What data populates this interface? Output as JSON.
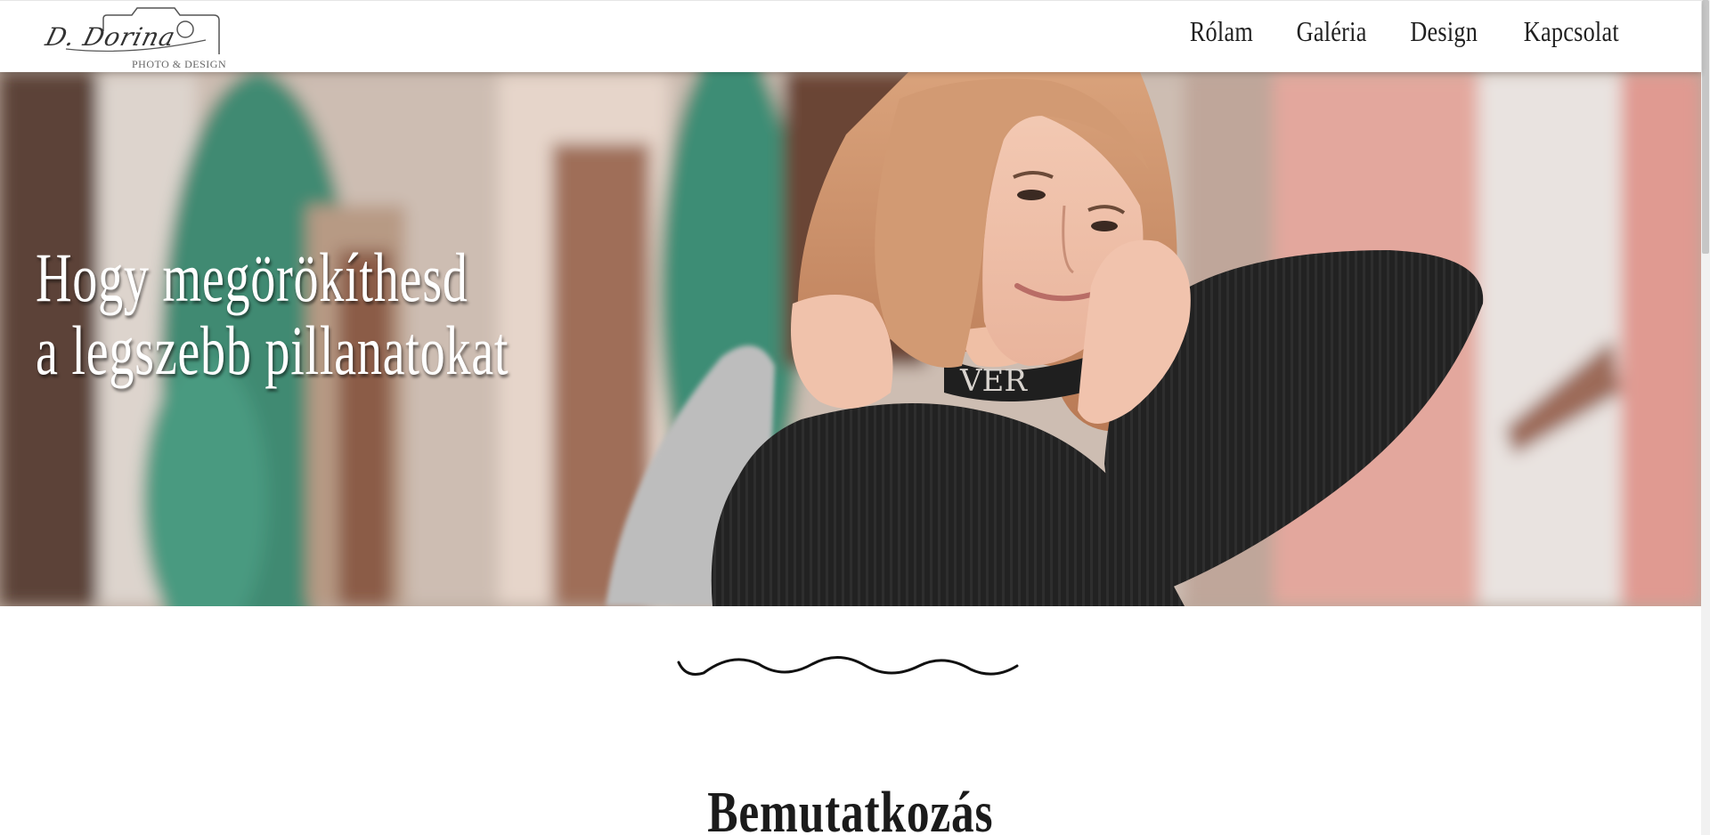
{
  "brand": {
    "script": "D. Dorina",
    "sub": "PHOTO & DESIGN"
  },
  "nav": [
    {
      "label": "Rólam"
    },
    {
      "label": "Galéria"
    },
    {
      "label": "Design"
    },
    {
      "label": "Kapcsolat"
    }
  ],
  "hero": {
    "line1": "Hogy megörökíthesd",
    "line2": "a legszebb pillanatokat",
    "sweater_text": "VER"
  },
  "section": {
    "title": "Bemutatkozás"
  },
  "icons": {
    "logo": "camera-outline-icon",
    "divider": "wave-divider-icon"
  },
  "colors": {
    "ivy": "#3f8a72",
    "wall_pink": "#e2a198",
    "text_dark": "#1f1f1f"
  }
}
